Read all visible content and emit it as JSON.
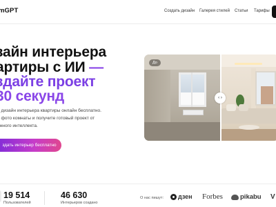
{
  "header": {
    "logo": "mGPT",
    "nav": {
      "create": "Создать дизайн",
      "gallery": "Галерея стилей",
      "articles": "Статьи",
      "pricing": "Тарифы"
    }
  },
  "hero": {
    "title_line1": "зайн интерьера",
    "title_line2": "артиры с ИИ",
    "title_dash": "—",
    "title_line3": "здайте проект",
    "title_line4": "30 секунд",
    "desc_line1": "е дизайн интерьера квартиры онлайн бесплатно.",
    "desc_line2": "е фото комнаты и получите готовый проект от",
    "desc_line3": "енного интеллекта.",
    "cta": "здать интерьер бесплатно"
  },
  "preview": {
    "before_badge": "До",
    "handle_glyph": "‹ ›"
  },
  "stats": [
    {
      "value": "19 514",
      "label": "Пользователей"
    },
    {
      "value": "46 630",
      "label": "Интерьеров создано"
    }
  ],
  "press": {
    "label": "О нас пишут:",
    "dzen": "дзен",
    "forbes": "Forbes",
    "pikabu": "pikabu",
    "vc": "V"
  },
  "colors": {
    "accent_purple": "#7b3fe4",
    "cta_gradient_start": "#7a2bd9",
    "cta_gradient_end": "#e0478f"
  }
}
